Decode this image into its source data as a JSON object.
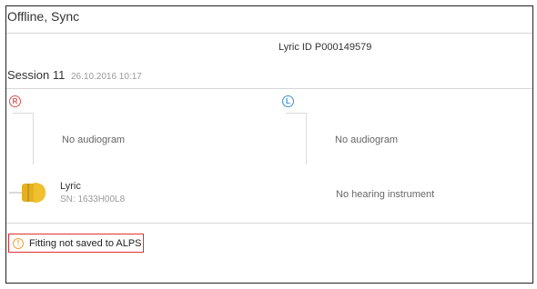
{
  "header": {
    "title": "Offline, Sync"
  },
  "lyric_id": "Lyric ID  P000149579",
  "session": {
    "title": "Session 11",
    "date": "26.10.2016 10:17"
  },
  "ears": {
    "right": {
      "badge": "R",
      "color": "#d9534f",
      "audiogram_text": "No audiogram"
    },
    "left": {
      "badge": "L",
      "color": "#3a8fd0",
      "audiogram_text": "No audiogram"
    }
  },
  "hearing_instruments": {
    "right": {
      "name": "Lyric",
      "serial": "SN: 1633H00L8",
      "icon": "hearing-aid-icon",
      "color": "#e3b020"
    },
    "left": {
      "text": "No hearing instrument"
    }
  },
  "warning": {
    "text": "Fitting not saved to ALPS",
    "icon": "warning-icon",
    "icon_color": "#f0a030",
    "border_color": "#e03030"
  }
}
